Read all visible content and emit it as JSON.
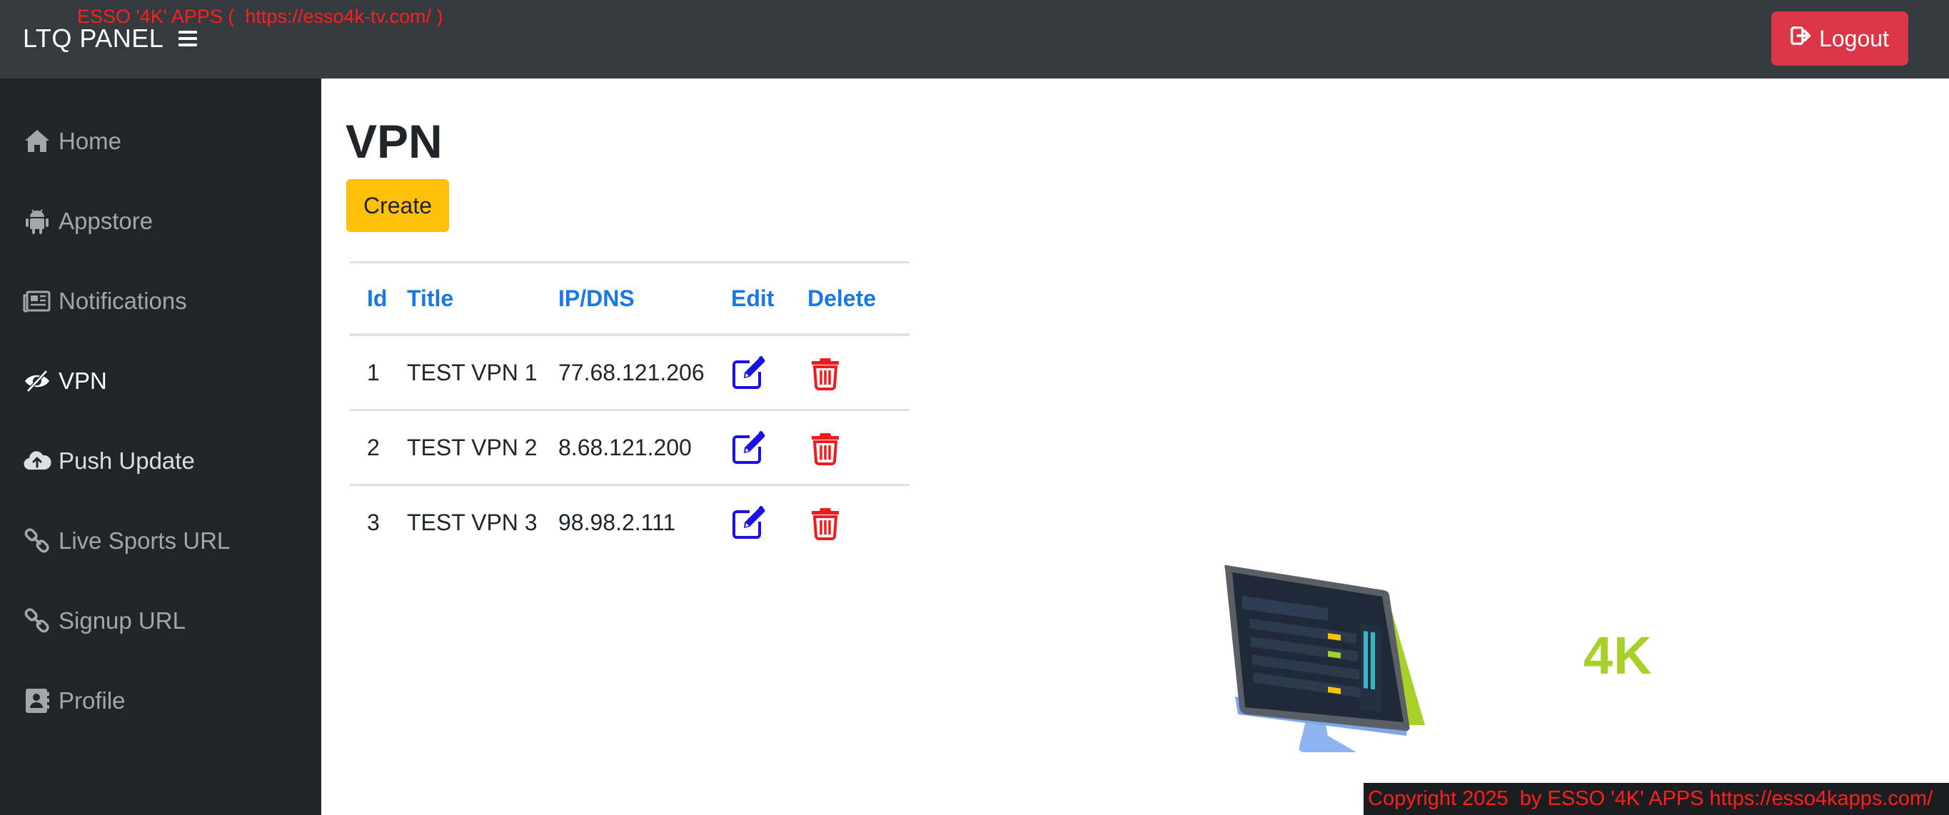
{
  "brand": "LTQ PANEL",
  "banner": "ESSO '4K' APPS (  https://esso4k-tv.com/ )",
  "logout_label": "Logout",
  "sidebar": {
    "items": [
      {
        "label": "Home",
        "icon": "home-icon"
      },
      {
        "label": "Appstore",
        "icon": "android-icon"
      },
      {
        "label": "Notifications",
        "icon": "newspaper-icon"
      },
      {
        "label": "VPN",
        "icon": "eye-slash-icon",
        "active": true
      },
      {
        "label": "Push Update",
        "icon": "cloud-upload-icon"
      },
      {
        "label": "Live Sports URL",
        "icon": "link-icon"
      },
      {
        "label": "Signup URL",
        "icon": "link-icon"
      },
      {
        "label": "Profile",
        "icon": "address-book-icon"
      }
    ]
  },
  "main": {
    "title": "VPN",
    "create_label": "Create",
    "table": {
      "headers": [
        "Id",
        "Title",
        "IP/DNS",
        "Edit",
        "Delete"
      ],
      "rows": [
        {
          "id": "1",
          "title": "TEST VPN 1",
          "ip": "77.68.121.206"
        },
        {
          "id": "2",
          "title": "TEST VPN 2",
          "ip": "8.68.121.200"
        },
        {
          "id": "3",
          "title": "TEST VPN 3",
          "ip": "98.98.2.111"
        }
      ]
    }
  },
  "promo_text": "4K",
  "footer": "Copyright 2025  by ESSO '4K' APPS https://esso4kapps.com/",
  "colors": {
    "topbar": "#343a40",
    "sidebar": "#212529",
    "logout": "#dc3545",
    "create": "#ffc107",
    "header_link": "#1a78e6",
    "edit_icon": "#1a12e0",
    "delete_icon": "#ee1c1c",
    "banner_text": "#ff1e1e",
    "promo": "#a7d129"
  }
}
